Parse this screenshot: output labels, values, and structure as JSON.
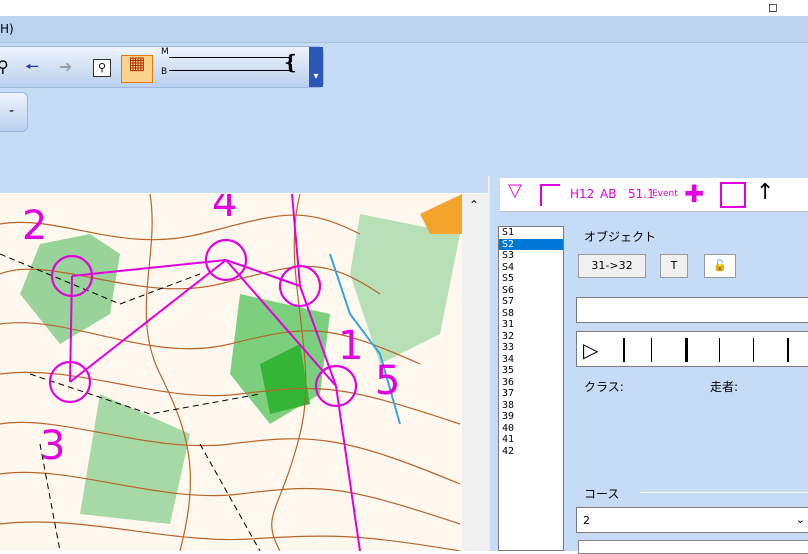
{
  "menu": {
    "label": "H)"
  },
  "toolbar": {
    "icons": [
      "search-icon",
      "arrow-left-icon",
      "arrow-right-icon",
      "zoom-box-icon",
      "grid-icon",
      "slider",
      "dropdown-icon"
    ],
    "slider_labels": {
      "m": "M",
      "b": "B"
    },
    "small_button": "-"
  },
  "symbols": {
    "items": [
      "H12",
      "AB",
      "51.1",
      "Event"
    ]
  },
  "course_list": [
    "S1",
    "S2",
    "S3",
    "S4",
    "S5",
    "S6",
    "S7",
    "S8",
    "31",
    "32",
    "33",
    "34",
    "35",
    "36",
    "37",
    "38",
    "39",
    "40",
    "41",
    "42"
  ],
  "course_selected": "S2",
  "object_panel": {
    "title": "オブジェクト",
    "range_button": "31->32",
    "t_button": "T",
    "class_label": "クラス:",
    "runner_label": "走者:",
    "course_label": "コース",
    "course_value": "2"
  },
  "map_controls": {
    "labels": [
      "1",
      "2",
      "3",
      "4",
      "5"
    ]
  },
  "colors": {
    "accent": "#e000e0",
    "selected": "#0078d7",
    "panel": "#c6dbf5"
  }
}
